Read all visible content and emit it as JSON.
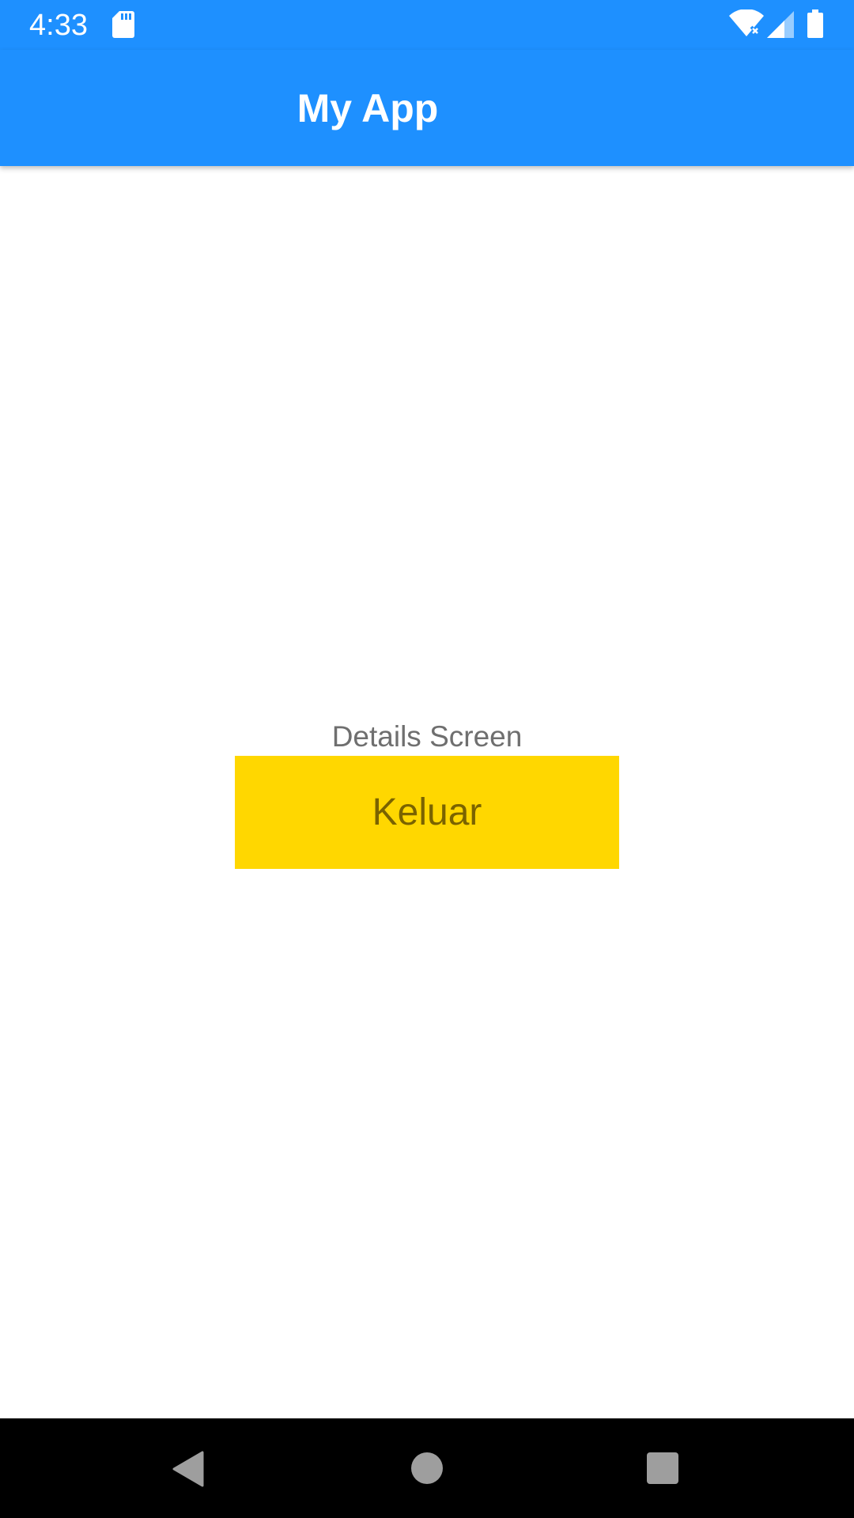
{
  "status_bar": {
    "time": "4:33",
    "icons": [
      "sd-card-icon",
      "wifi-icon",
      "signal-icon",
      "battery-icon"
    ]
  },
  "app_bar": {
    "title": "My App",
    "background_color": "#1e90ff"
  },
  "main": {
    "label": "Details Screen",
    "button_label": "Keluar",
    "button_color": "#ffd700"
  },
  "nav_bar": {
    "icons": [
      "back-icon",
      "home-icon",
      "recents-icon"
    ]
  }
}
